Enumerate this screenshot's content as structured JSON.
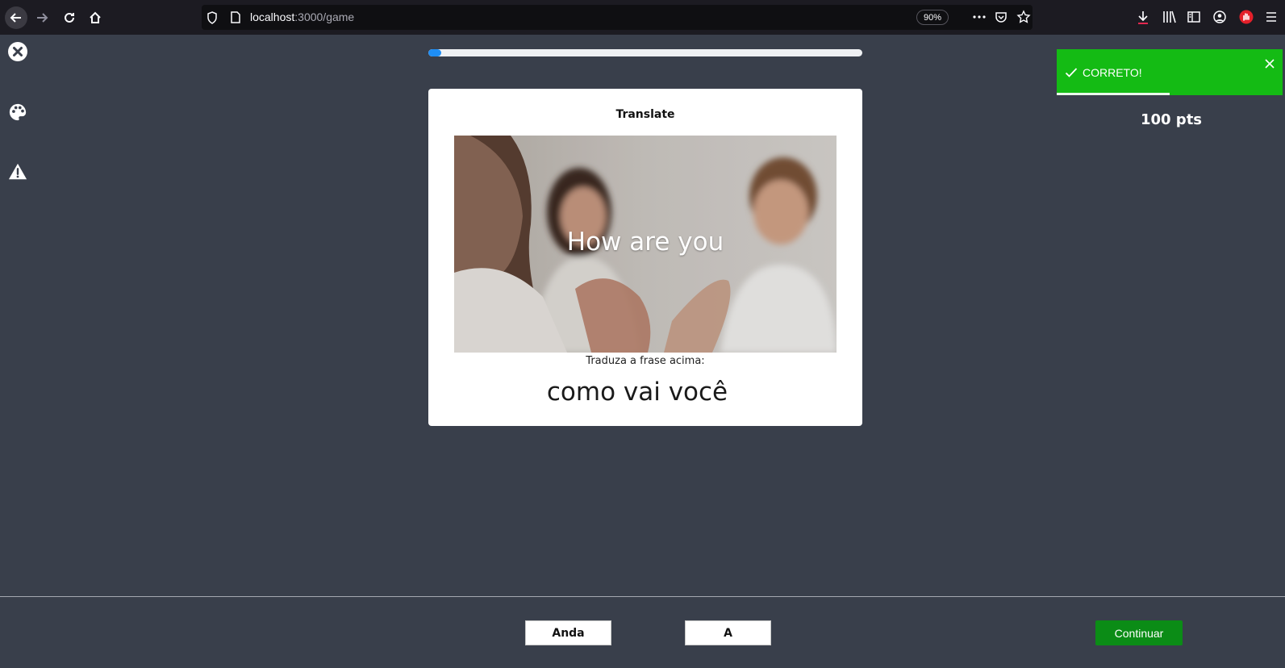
{
  "browser": {
    "url_host": "localhost",
    "url_path": ":3000/game",
    "zoom": "90%",
    "icons": [
      "back-icon",
      "forward-icon",
      "reload-icon",
      "home-icon",
      "shield-icon",
      "page-icon",
      "more-icon",
      "pocket-icon",
      "star-icon",
      "download-icon",
      "library-icon",
      "sidebar-icon",
      "account-icon",
      "extension-icon",
      "menu-icon"
    ]
  },
  "left_rail": {
    "icons": [
      "close-icon",
      "palette-icon",
      "warning-icon"
    ]
  },
  "progress": {
    "value": 0.03,
    "color": "#1e8ef6"
  },
  "card": {
    "title": "Translate",
    "phrase": "How are you",
    "prompt": "Traduza a frase acima:",
    "answer": "como vai você"
  },
  "toast": {
    "message": "CORRETO!",
    "color": "#14bb14",
    "timer_remaining": 0.5
  },
  "score": "100 pts",
  "footer": {
    "word_options": [
      "Anda",
      "A"
    ],
    "continue_label": "Continuar",
    "continue_color": "#0b8c16"
  }
}
